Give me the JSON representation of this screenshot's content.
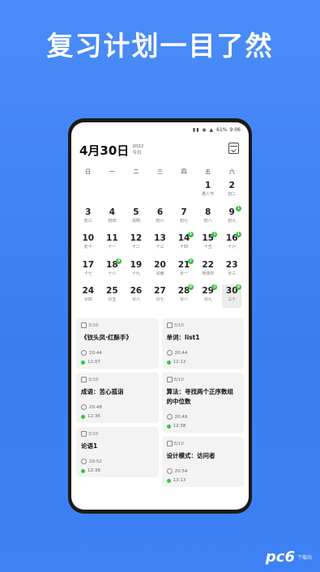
{
  "headline": "复习计划一目了然",
  "status_bar": {
    "battery": "61%",
    "time": "9:06"
  },
  "header": {
    "date": "4月30日",
    "year": "2022",
    "today_label": "今日"
  },
  "weekdays": [
    "日",
    "一",
    "二",
    "三",
    "四",
    "五",
    "六"
  ],
  "calendar": [
    {
      "num": "",
      "lunar": ""
    },
    {
      "num": "",
      "lunar": ""
    },
    {
      "num": "",
      "lunar": ""
    },
    {
      "num": "",
      "lunar": ""
    },
    {
      "num": "",
      "lunar": ""
    },
    {
      "num": "1",
      "lunar": "愚人节"
    },
    {
      "num": "2",
      "lunar": "初二"
    },
    {
      "num": "3",
      "lunar": "初三"
    },
    {
      "num": "4",
      "lunar": "初四"
    },
    {
      "num": "5",
      "lunar": "清明"
    },
    {
      "num": "6",
      "lunar": "初六"
    },
    {
      "num": "7",
      "lunar": "初七"
    },
    {
      "num": "8",
      "lunar": "初八"
    },
    {
      "num": "9",
      "lunar": "初九",
      "badge": "1"
    },
    {
      "num": "10",
      "lunar": "初十"
    },
    {
      "num": "11",
      "lunar": "十一"
    },
    {
      "num": "12",
      "lunar": "十二"
    },
    {
      "num": "13",
      "lunar": "十三"
    },
    {
      "num": "14",
      "lunar": "十四",
      "badge": "5"
    },
    {
      "num": "15",
      "lunar": "十五",
      "badge": "1"
    },
    {
      "num": "16",
      "lunar": "十六",
      "badge": "1"
    },
    {
      "num": "17",
      "lunar": "十七"
    },
    {
      "num": "18",
      "lunar": "十八",
      "badge": "4"
    },
    {
      "num": "19",
      "lunar": "十九"
    },
    {
      "num": "20",
      "lunar": "谷雨"
    },
    {
      "num": "21",
      "lunar": "廿一",
      "badge": "1"
    },
    {
      "num": "22",
      "lunar": "地球日"
    },
    {
      "num": "23",
      "lunar": "廿三"
    },
    {
      "num": "24",
      "lunar": "廿四"
    },
    {
      "num": "25",
      "lunar": "廿五"
    },
    {
      "num": "26",
      "lunar": "廿六"
    },
    {
      "num": "27",
      "lunar": "廿七"
    },
    {
      "num": "28",
      "lunar": "廿八",
      "badge": "4"
    },
    {
      "num": "29",
      "lunar": "廿九",
      "badge": "1"
    },
    {
      "num": "30",
      "lunar": "三十",
      "badge": "4",
      "today": true
    }
  ],
  "cards": {
    "left": [
      {
        "count": "3/10",
        "title": "《钗头凤·红酥手》",
        "time": "20:44",
        "next": "12:07"
      },
      {
        "count": "3/10",
        "title": "成语：苦心孤诣",
        "time": "20:48",
        "next": "12:36"
      },
      {
        "count": "3/10",
        "title": "论语1",
        "time": "20:52",
        "next": "12:38"
      }
    ],
    "right": [
      {
        "count": "3/10",
        "title": "单词：list1",
        "time": "20:44",
        "next": "12:12"
      },
      {
        "count": "3/10",
        "title": "算法：寻找两个正序数组的中位数",
        "time": "20:49",
        "next": "12:38"
      },
      {
        "count": "3/10",
        "title": "设计模式：访问者",
        "time": "20:54",
        "next": "13:13"
      }
    ]
  },
  "watermark": {
    "logo": "pc6",
    "text": "下载站"
  }
}
